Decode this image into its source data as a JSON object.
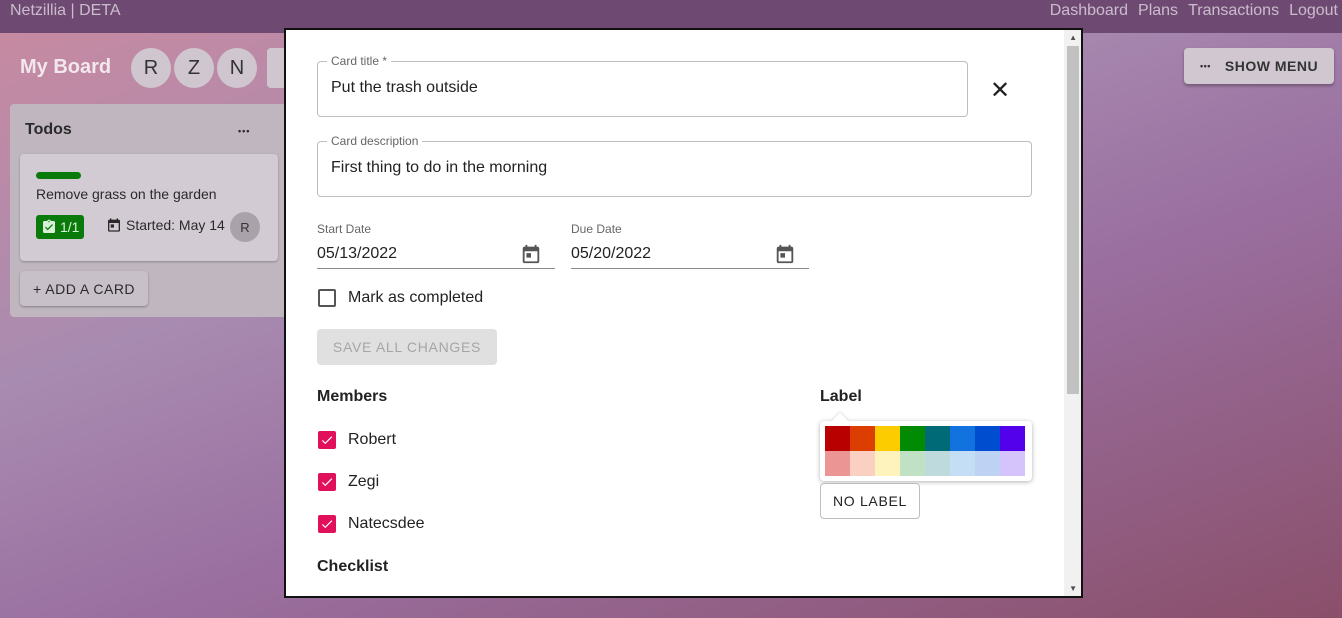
{
  "app": {
    "brand": "Netzillia | DETA"
  },
  "nav": [
    "Dashboard",
    "Plans",
    "Transactions",
    "Logout"
  ],
  "board": {
    "title": "My Board",
    "members": [
      "R",
      "Z",
      "N"
    ],
    "show_menu_label": "SHOW MENU",
    "dots": "•••"
  },
  "list": {
    "title": "Todos",
    "menu": "•••",
    "add_card_label": "+ ADD A CARD",
    "card": {
      "label_color": "#0a7a0a",
      "title": "Remove grass on the garden",
      "checklist": "1/1",
      "started": "Started: May 14",
      "avatar": "R"
    }
  },
  "dialog": {
    "card_title_legend": "Card title *",
    "card_title": "Put the trash outside",
    "description_legend": "Card description",
    "description": "First thing to do in the morning",
    "start_date_label": "Start Date",
    "start_date": "05/13/2022",
    "due_date_label": "Due Date",
    "due_date": "05/20/2022",
    "mark_completed_label": "Mark as completed",
    "mark_completed": false,
    "save_label": "SAVE ALL CHANGES",
    "members_heading": "Members",
    "members": [
      {
        "name": "Robert",
        "checked": true
      },
      {
        "name": "Zegi",
        "checked": true
      },
      {
        "name": "Natecsdee",
        "checked": true
      }
    ],
    "checklist_heading": "Checklist",
    "label_heading": "Label",
    "label_colors_strong": [
      "#b80000",
      "#db3e00",
      "#fccb00",
      "#008b02",
      "#006b76",
      "#1273de",
      "#004dcf",
      "#5300eb"
    ],
    "label_colors_light": [
      "#eb9694",
      "#fad0c3",
      "#fef3bd",
      "#c1e1c5",
      "#bedadc",
      "#c4def6",
      "#bed3f3",
      "#d4c4fb"
    ],
    "no_label": "NO LABEL"
  }
}
